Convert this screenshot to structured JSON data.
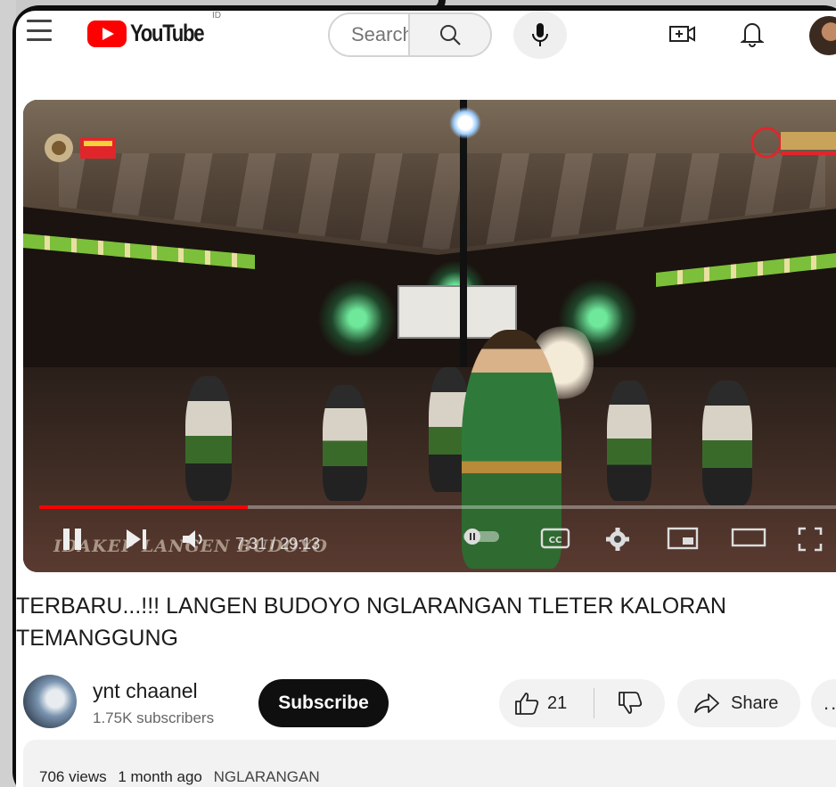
{
  "header": {
    "logo_text": "YouTube",
    "region_code": "ID",
    "search_placeholder": "Search"
  },
  "player": {
    "current_time": "7:31",
    "duration": "29:13",
    "watermark_title": "IDAKEP LANGEN BUDOYO",
    "progress_fraction": 0.26
  },
  "video": {
    "title": "TERBARU...!!! LANGEN BUDOYO NGLARANGAN TLETER KALORAN TEMANGGUNG"
  },
  "channel": {
    "name": "ynt chaanel",
    "subscribers": "1.75K subscribers",
    "subscribe_label": "Subscribe"
  },
  "actions": {
    "likes": "21",
    "share_label": "Share",
    "more_label": "..."
  },
  "description": {
    "views": "706 views",
    "age": "1 month ago",
    "tag": "NGLARANGAN"
  },
  "colors": {
    "brand_red": "#ff0000",
    "subscribe_bg": "#0f0f0f",
    "pill_bg": "#f2f2f2"
  }
}
